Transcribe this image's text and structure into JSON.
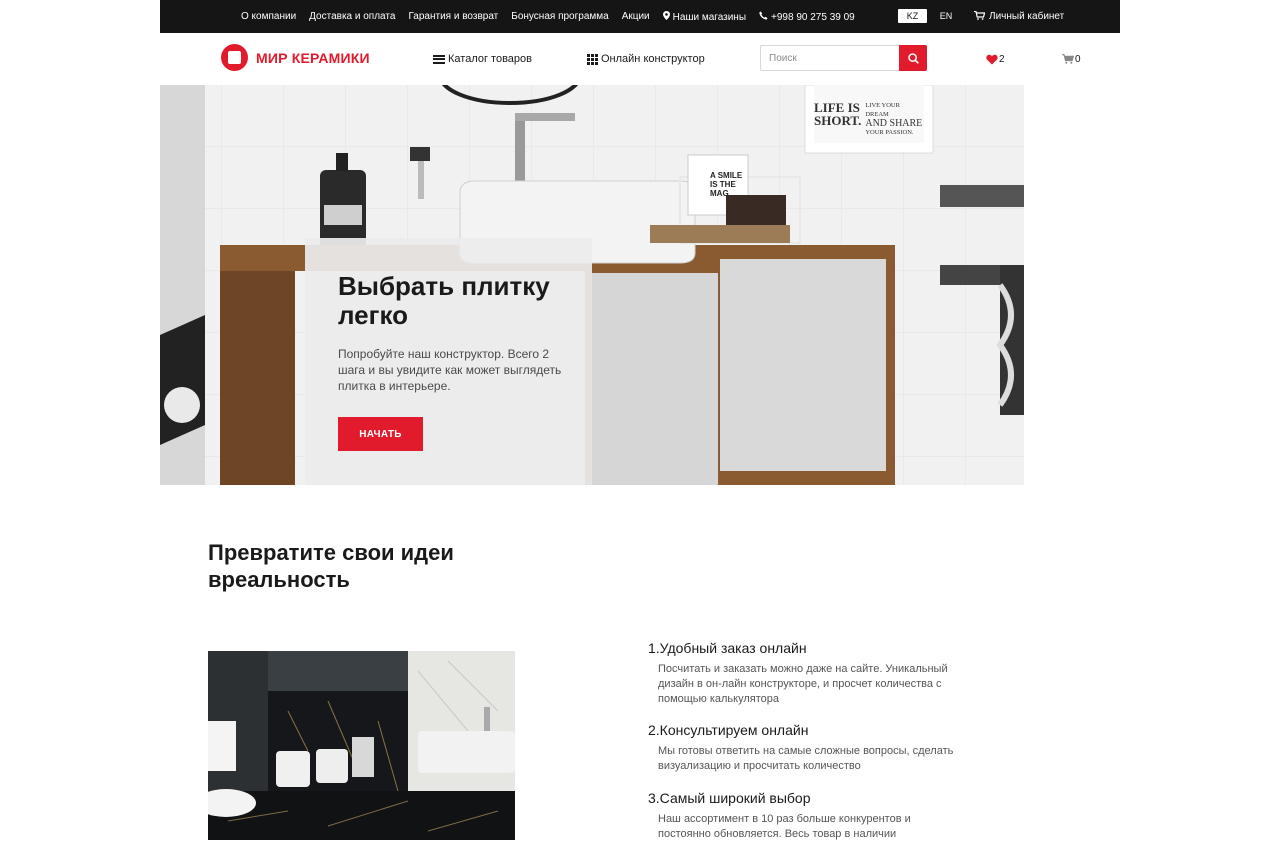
{
  "topbar": {
    "links": [
      "О компании",
      "Доставка и оплата",
      "Гарантия и возврат",
      "Бонусная программа",
      "Акции"
    ],
    "stores": "Наши магазины",
    "phone": "+998 90 275 39 09",
    "lang_kz": "KZ",
    "lang_en": "EN",
    "cabinet": "Личный кабинет"
  },
  "header": {
    "logo_text": "МИР КЕРАМИКИ",
    "catalog": "Каталог товаров",
    "builder": "Онлайн конструктор",
    "search_placeholder": "Поиск",
    "favorites_count": "2",
    "cart_count": "0"
  },
  "hero": {
    "title": "Выбрать плитку легко",
    "text": "Попробуйте наш конструктор. Всего 2 шага и вы увидите как может выглядеть плитка в интерьере.",
    "button": "НАЧАТЬ",
    "poster_text": [
      "LIFE IS",
      "SHORT.",
      "LIVE YOUR DREAM",
      "AND SHARE",
      "YOUR PASSION."
    ],
    "book_text": [
      "A SMILE",
      "IS THE",
      "MAG"
    ]
  },
  "section": {
    "title": "Превратите свои идеи вреальность",
    "features": [
      {
        "title": "1.Удобный заказ онлайн",
        "text": "Посчитать и заказать можно даже на сайте. Уникальный дизайн в он-лайн конструкторе, и просчет количества с помощью калькулятора"
      },
      {
        "title": "2.Консультируем онлайн",
        "text": "Мы готовы ответить на самые сложные вопросы, сделать визуализацию и просчитать количество"
      },
      {
        "title": "3.Самый широкий выбор",
        "text": "Наш ассортимент в 10 раз больше конкурентов и постоянно обновляется. Весь товар в наличии"
      }
    ]
  },
  "colors": {
    "accent": "#e11a2c",
    "topbar": "#151515"
  }
}
